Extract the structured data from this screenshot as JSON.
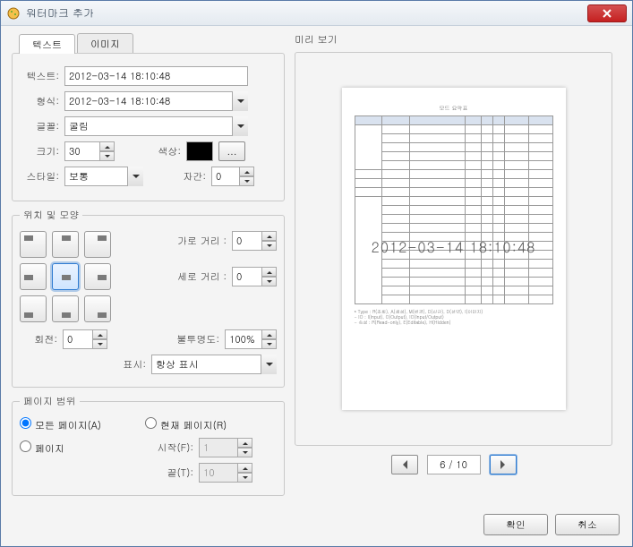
{
  "window": {
    "title": "워터마크 추가"
  },
  "tabs": {
    "text": "텍스트",
    "image": "이미지"
  },
  "fields": {
    "text_label": "텍스트:",
    "text_value": "2012-03-14 18:10:48",
    "format_label": "형식:",
    "format_value": "2012-03-14 18:10:48",
    "font_label": "글꼴:",
    "font_value": "굴림",
    "size_label": "크기:",
    "size_value": "30",
    "color_label": "색상:",
    "color_more": "...",
    "style_label": "스타일:",
    "style_value": "보통",
    "tracking_label": "자간:",
    "tracking_value": "0"
  },
  "position": {
    "legend": "위치 및 모양",
    "hdist_label": "가로 거리 :",
    "hdist_value": "0",
    "vdist_label": "세로 거리 :",
    "vdist_value": "0",
    "rotate_label": "회전:",
    "rotate_value": "0",
    "opacity_label": "불투명도:",
    "opacity_value": "100%",
    "display_label": "표시:",
    "display_value": "항상 표시",
    "selected": "mc"
  },
  "range": {
    "legend": "페이지 범위",
    "all_label": "모든 페이지(A)",
    "current_label": "현재 페이지(R)",
    "pages_label": "페이지",
    "from_label": "시작(F):",
    "from_value": "1",
    "to_label": "끝(T):",
    "to_value": "10",
    "selected": "all"
  },
  "preview": {
    "label": "미리 보기",
    "page_display": "6 / 10",
    "watermark_text": "2012-03-14 18:10:48"
  },
  "buttons": {
    "ok": "확인",
    "cancel": "취소"
  },
  "colors": {
    "swatch": "#000000"
  }
}
